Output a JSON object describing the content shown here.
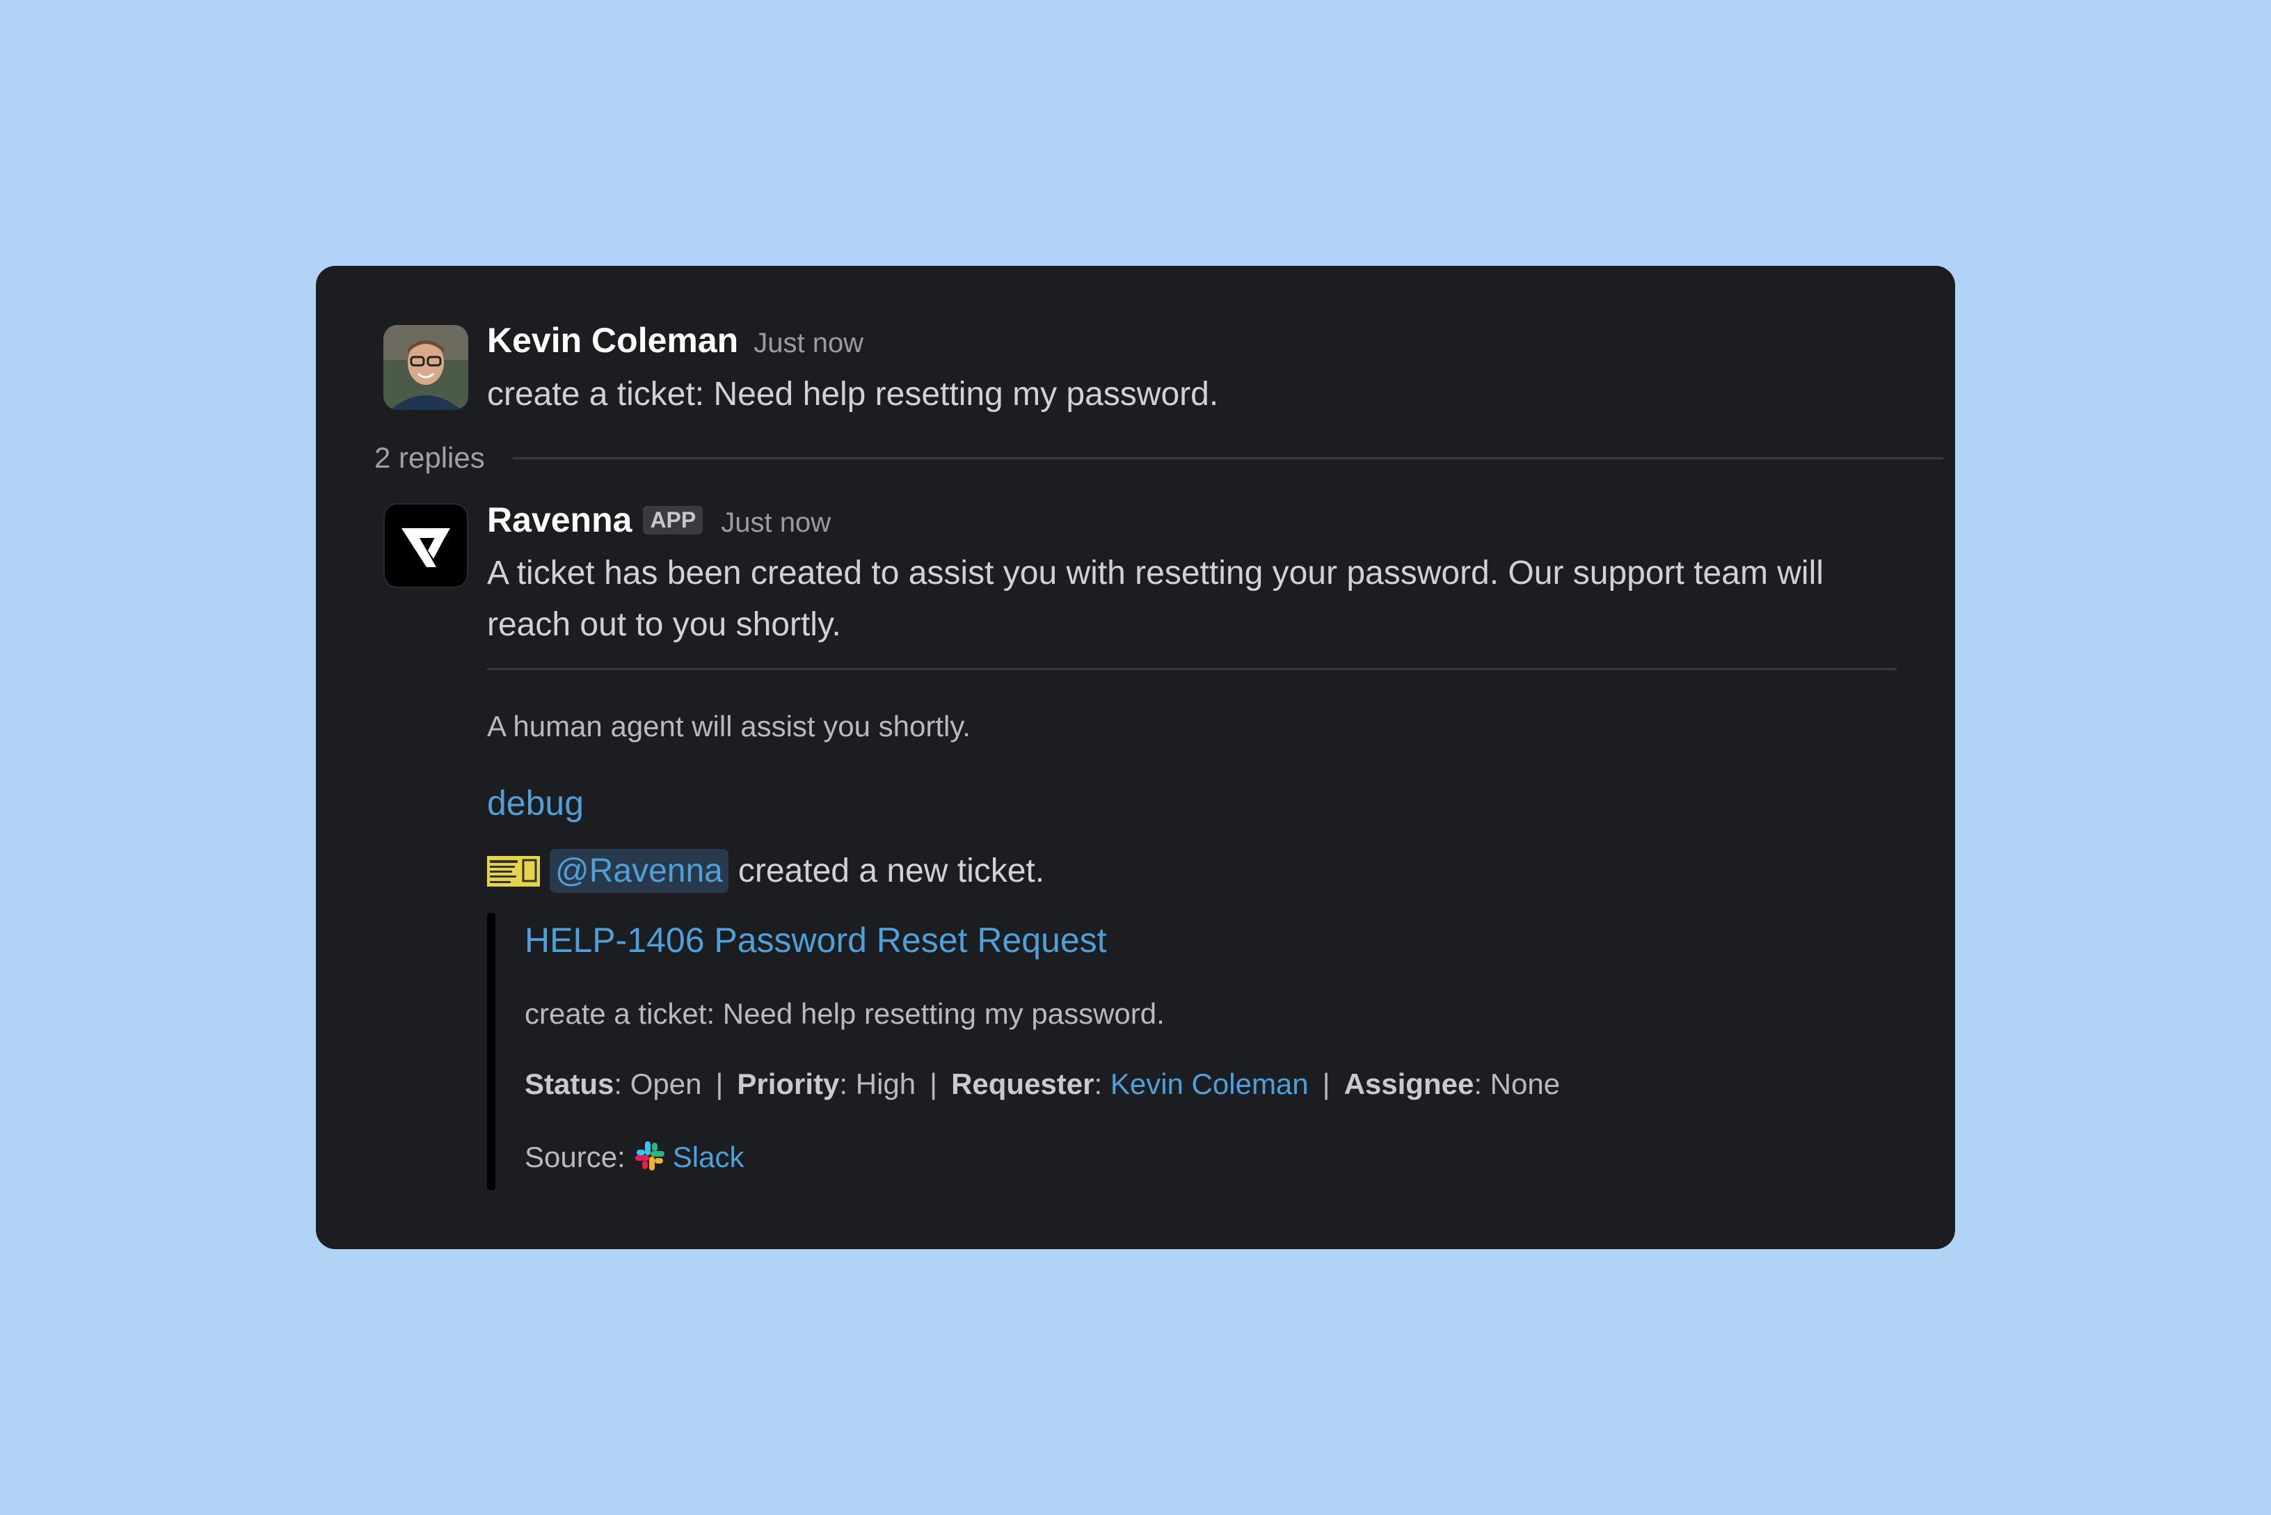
{
  "message1": {
    "author": "Kevin Coleman",
    "time": "Just now",
    "text": "create a ticket: Need help resetting my password."
  },
  "thread": {
    "replies_label": "2 replies"
  },
  "message2": {
    "author": "Ravenna",
    "badge": "APP",
    "time": "Just now",
    "text": "A ticket has been created to assist you with resetting your password. Our support team will reach out to you shortly.",
    "note": "A human agent will assist you shortly.",
    "debug_link": "debug",
    "mention": "@Ravenna",
    "created_text": "created a new ticket."
  },
  "ticket": {
    "title": "HELP-1406 Password Reset Request",
    "description": "create a ticket: Need help resetting my password.",
    "status_label": "Status",
    "status": "Open",
    "priority_label": "Priority",
    "priority": "High",
    "requester_label": "Requester",
    "requester": "Kevin Coleman",
    "assignee_label": "Assignee",
    "assignee": "None",
    "source_label": "Source:",
    "source": "Slack"
  },
  "colors": {
    "background": "#b1d4f6",
    "card": "#1c1d20",
    "link": "#4fa0d8"
  },
  "icons": {
    "ticket": "ticket-emoji-icon",
    "source": "slack-logo-icon"
  }
}
